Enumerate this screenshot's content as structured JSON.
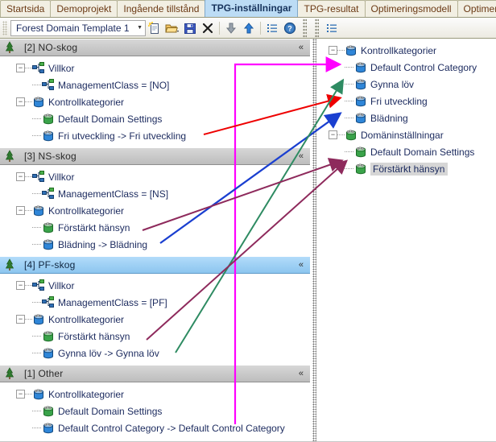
{
  "tabs": [
    {
      "label": "Startsida",
      "active": false
    },
    {
      "label": "Demoprojekt",
      "active": false
    },
    {
      "label": "Ingående tillstånd",
      "active": false
    },
    {
      "label": "TPG-inställningar",
      "active": true
    },
    {
      "label": "TPG-resultat",
      "active": false
    },
    {
      "label": "Optimeringsmodell",
      "active": false
    },
    {
      "label": "Optimerings",
      "active": false
    }
  ],
  "toolbar": {
    "template_value": "Forest Domain Template 1",
    "caret": "▼",
    "buttons": [
      {
        "name": "new-document-button",
        "title": "Ny"
      },
      {
        "name": "open-folder-button",
        "title": "Öppna"
      },
      {
        "name": "save-button",
        "title": "Spara"
      },
      {
        "name": "delete-button",
        "title": "Ta bort"
      },
      {
        "name": "move-down-button",
        "title": "Ned"
      },
      {
        "name": "move-up-button",
        "title": "Upp"
      },
      {
        "name": "list-button",
        "title": "Lista"
      },
      {
        "name": "help-button",
        "title": "Hjälp"
      }
    ],
    "right_list_button": "Lista"
  },
  "left_panel": {
    "groups": [
      {
        "header": "[2]  NO-skog",
        "selected": false,
        "collapse_glyph": "«",
        "nodes": [
          {
            "label": "Villkor",
            "icon": "network-node-icon",
            "depth": 0,
            "expander": "−"
          },
          {
            "label": "ManagementClass =  [NO]",
            "icon": "network-node-icon",
            "depth": 1,
            "expander": ""
          },
          {
            "label": "Kontrollkategorier",
            "icon": "cylinder-blue-icon",
            "depth": 0,
            "expander": "−"
          },
          {
            "label": "Default Domain Settings",
            "icon": "cylinder-green-icon",
            "depth": 1,
            "expander": ""
          },
          {
            "label": "Fri utveckling -> Fri utveckling",
            "icon": "cylinder-blue-icon",
            "depth": 1,
            "expander": ""
          }
        ]
      },
      {
        "header": "[3]  NS-skog",
        "selected": false,
        "collapse_glyph": "«",
        "nodes": [
          {
            "label": "Villkor",
            "icon": "network-node-icon",
            "depth": 0,
            "expander": "−"
          },
          {
            "label": "ManagementClass =  [NS]",
            "icon": "network-node-icon",
            "depth": 1,
            "expander": ""
          },
          {
            "label": "Kontrollkategorier",
            "icon": "cylinder-blue-icon",
            "depth": 0,
            "expander": "−"
          },
          {
            "label": "Förstärkt hänsyn",
            "icon": "cylinder-green-icon",
            "depth": 1,
            "expander": ""
          },
          {
            "label": "Blädning -> Blädning",
            "icon": "cylinder-blue-icon",
            "depth": 1,
            "expander": ""
          }
        ]
      },
      {
        "header": "[4]  PF-skog",
        "selected": true,
        "collapse_glyph": "«",
        "nodes": [
          {
            "label": "Villkor",
            "icon": "network-node-icon",
            "depth": 0,
            "expander": "−"
          },
          {
            "label": "ManagementClass =  [PF]",
            "icon": "network-node-icon",
            "depth": 1,
            "expander": ""
          },
          {
            "label": "Kontrollkategorier",
            "icon": "cylinder-blue-icon",
            "depth": 0,
            "expander": "−"
          },
          {
            "label": "Förstärkt hänsyn",
            "icon": "cylinder-green-icon",
            "depth": 1,
            "expander": ""
          },
          {
            "label": "Gynna löv -> Gynna löv",
            "icon": "cylinder-blue-icon",
            "depth": 1,
            "expander": ""
          }
        ]
      },
      {
        "header": "[1]  Other",
        "selected": false,
        "collapse_glyph": "«",
        "nodes": [
          {
            "label": "Kontrollkategorier",
            "icon": "cylinder-blue-icon",
            "depth": 0,
            "expander": "−"
          },
          {
            "label": "Default Domain Settings",
            "icon": "cylinder-green-icon",
            "depth": 1,
            "expander": ""
          },
          {
            "label": "Default Control Category -> Default Control Category",
            "icon": "cylinder-blue-icon",
            "depth": 1,
            "expander": ""
          }
        ]
      }
    ]
  },
  "right_panel": {
    "nodes": [
      {
        "label": "Kontrollkategorier",
        "icon": "cylinder-blue-icon",
        "depth": 0,
        "expander": "−",
        "highlight": false
      },
      {
        "label": "Default Control Category",
        "icon": "cylinder-blue-icon",
        "depth": 1,
        "expander": "",
        "highlight": false
      },
      {
        "label": "Gynna löv",
        "icon": "cylinder-blue-icon",
        "depth": 1,
        "expander": "",
        "highlight": false
      },
      {
        "label": "Fri utveckling",
        "icon": "cylinder-blue-icon",
        "depth": 1,
        "expander": "",
        "highlight": false
      },
      {
        "label": "Blädning",
        "icon": "cylinder-blue-icon",
        "depth": 1,
        "expander": "",
        "highlight": false
      },
      {
        "label": "Domäninställningar",
        "icon": "cylinder-green-icon",
        "depth": 0,
        "expander": "−",
        "highlight": false
      },
      {
        "label": "Default Domain Settings",
        "icon": "cylinder-green-icon",
        "depth": 1,
        "expander": "",
        "highlight": false
      },
      {
        "label": "Förstärkt hänsyn",
        "icon": "cylinder-green-icon",
        "depth": 1,
        "expander": "",
        "highlight": true
      }
    ]
  },
  "annotations": {
    "colors": {
      "magenta": "#ff00ff",
      "red": "#ee0000",
      "blue": "#1a3fd0",
      "green": "#2e8b62",
      "maroon": "#8e2a5c"
    },
    "arrows": [
      {
        "name": "magenta-default-control-category",
        "color": "#ff00ff"
      },
      {
        "name": "red-fri-utveckling",
        "color": "#ee0000"
      },
      {
        "name": "blue-bladning",
        "color": "#1a3fd0"
      },
      {
        "name": "green-gynna-lov",
        "color": "#2e8b62"
      },
      {
        "name": "maroon-forstarkt-hansyn-ns",
        "color": "#8e2a5c"
      },
      {
        "name": "maroon-forstarkt-hansyn-pf",
        "color": "#8e2a5c"
      }
    ]
  }
}
